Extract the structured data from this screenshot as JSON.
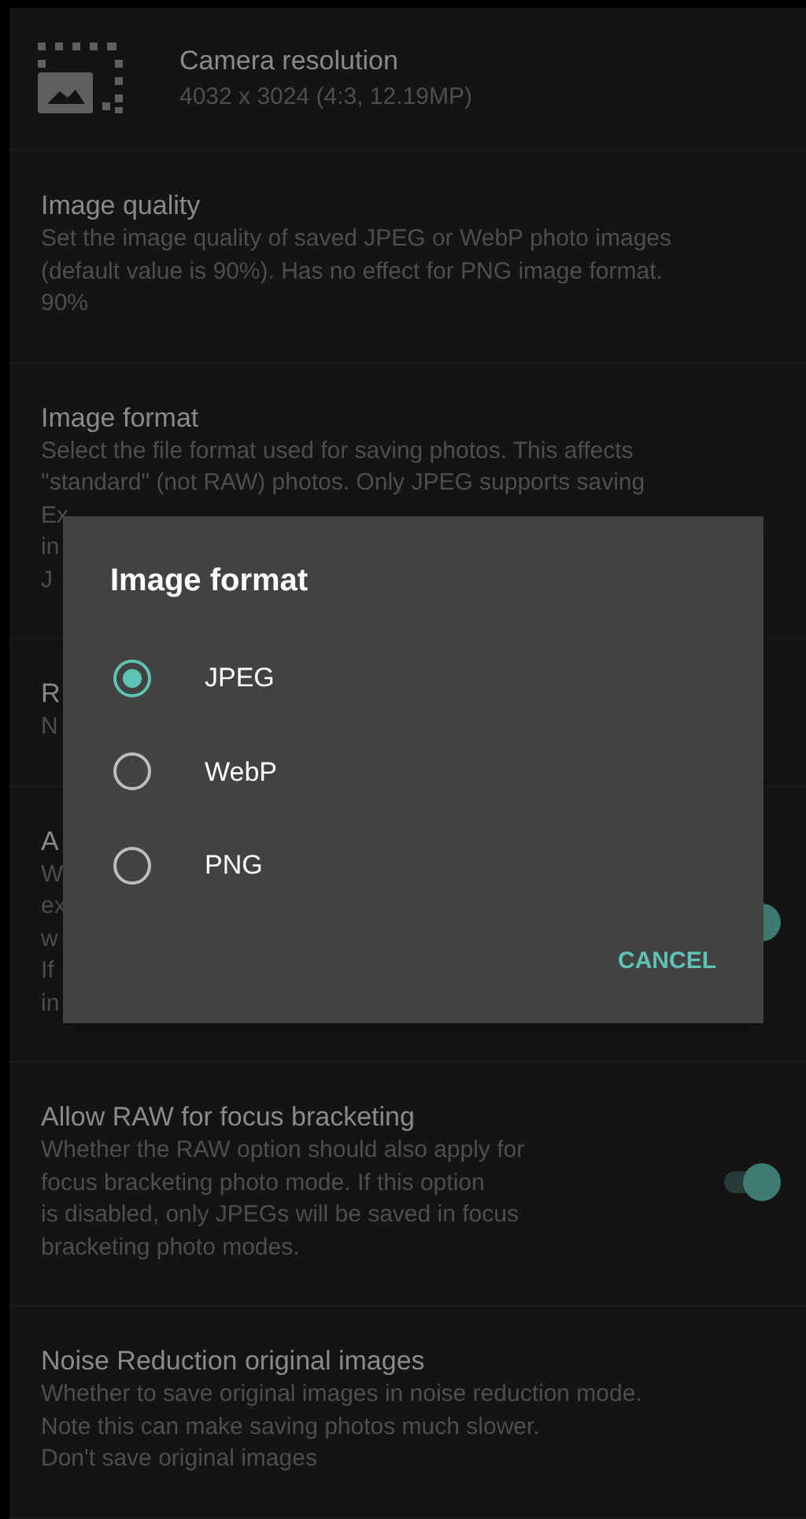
{
  "settings": [
    {
      "kind": "icon",
      "title": "Camera resolution",
      "summary": [
        "4032 x 3024 (4:3, 12.19MP)"
      ]
    },
    {
      "kind": "text",
      "title": "Image quality",
      "summary": [
        "Set the image quality of saved JPEG or WebP photo images",
        "(default value is 90%). Has no effect for PNG image format.",
        "90%"
      ]
    },
    {
      "kind": "text",
      "title": "Image format",
      "summary": [
        "Select the file format used for saving photos. This affects",
        "\"standard\" (not RAW) photos. Only JPEG supports saving",
        "Ex",
        "in",
        "J"
      ]
    },
    {
      "kind": "text",
      "title": "R",
      "summary": [
        "N"
      ]
    },
    {
      "kind": "switch",
      "title": "A",
      "summary": [
        "W",
        "ex",
        "w",
        "If",
        "in"
      ],
      "on": true
    },
    {
      "kind": "switch",
      "title": "Allow RAW for focus bracketing",
      "summary": [
        "Whether the RAW option should also apply for",
        "focus bracketing photo mode. If this option",
        "is disabled, only JPEGs will be saved in focus",
        "bracketing photo modes."
      ],
      "on": true
    },
    {
      "kind": "text",
      "title": "Noise Reduction original images",
      "summary": [
        "Whether to save original images in noise reduction mode.",
        "Note this can make saving photos much slower.",
        "Don't save original images"
      ]
    }
  ],
  "dialog": {
    "title": "Image format",
    "options": [
      {
        "label": "JPEG",
        "selected": true
      },
      {
        "label": "WebP",
        "selected": false
      },
      {
        "label": "PNG",
        "selected": false
      }
    ],
    "buttons": [
      "CANCEL"
    ]
  }
}
